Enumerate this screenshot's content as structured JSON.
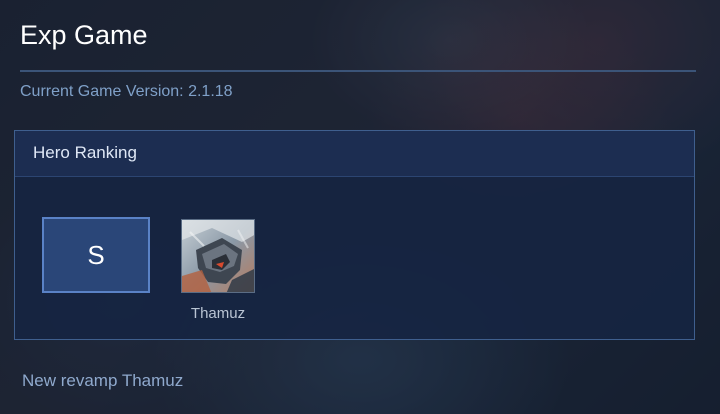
{
  "page": {
    "title": "Exp Game",
    "version_text": "Current Game Version: 2.1.18"
  },
  "ranking": {
    "header": "Hero Ranking",
    "tiers": [
      {
        "label": "S",
        "heroes": [
          {
            "name": "Thamuz",
            "icon": "thamuz-portrait"
          }
        ]
      }
    ]
  },
  "note": "New revamp Thamuz",
  "colors": {
    "accent": "#5a82c6",
    "panel_bg": "#16243f",
    "version_text": "#7fa0c8"
  }
}
